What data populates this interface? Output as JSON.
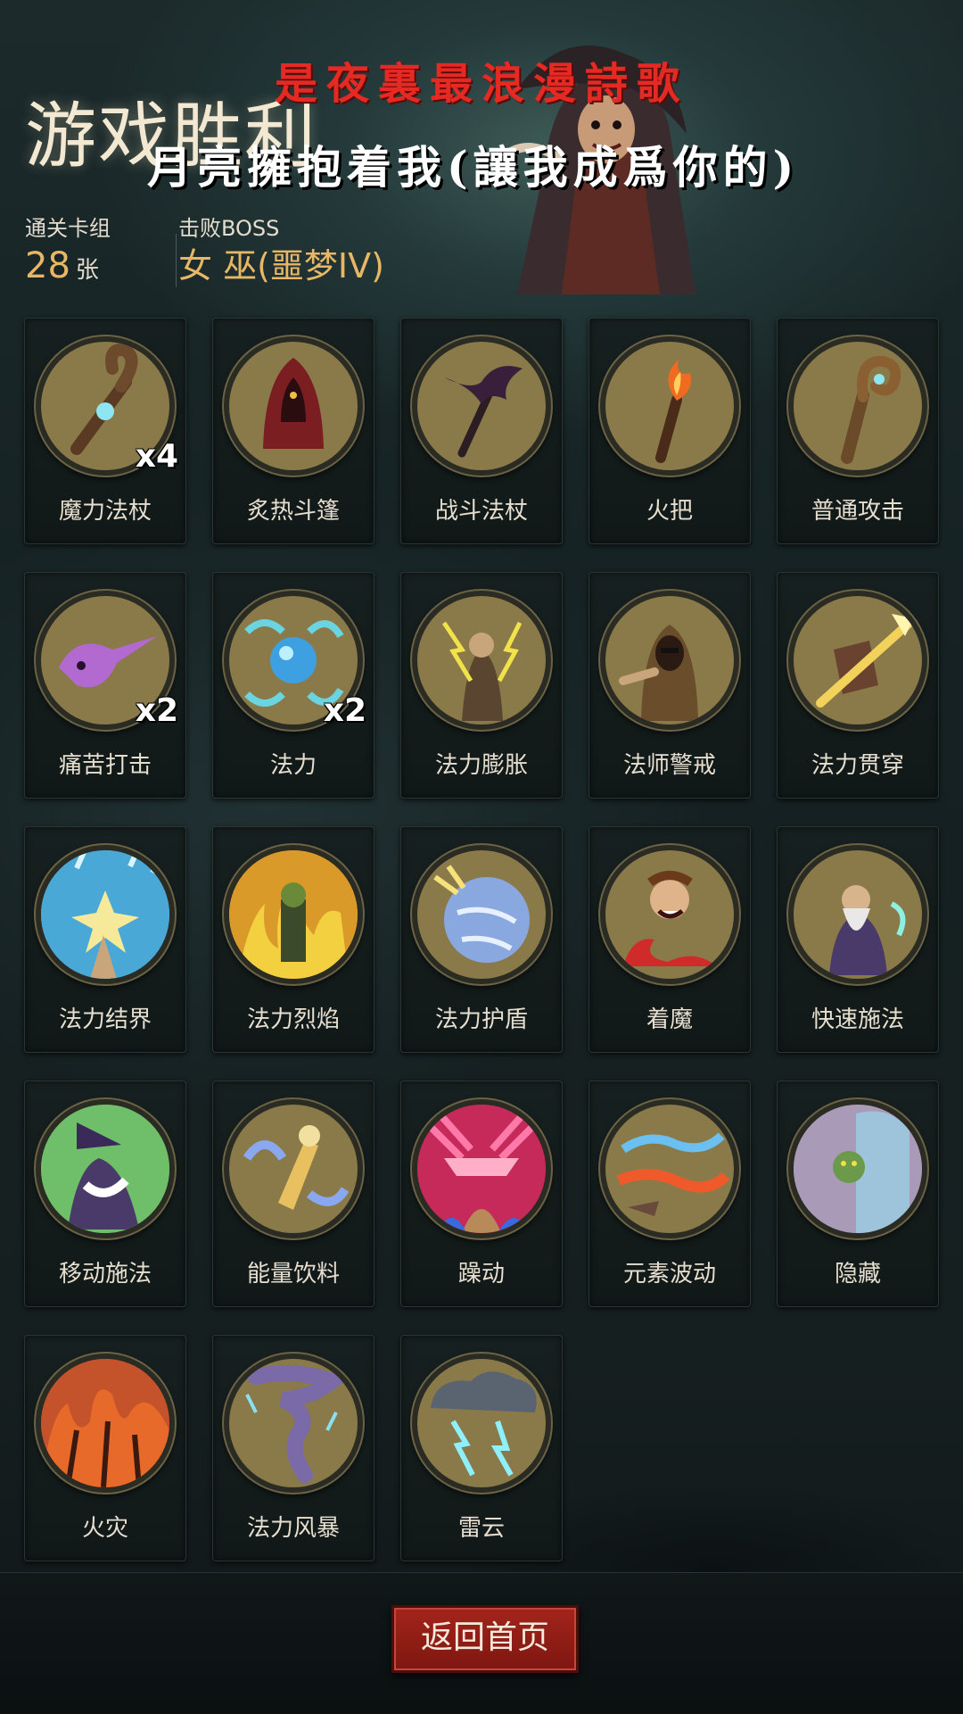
{
  "header": {
    "title": "游戏胜利",
    "overlay_line1": "是夜裏最浪漫詩歌",
    "overlay_line2": "月亮擁抱着我(讓我成爲你的)",
    "deck": {
      "label": "通关卡组",
      "value": "28",
      "unit": "张"
    },
    "boss": {
      "label": "击败BOSS",
      "value": "女 巫(噩梦IV)"
    }
  },
  "cards": [
    {
      "name": "魔力法杖",
      "count": "x4",
      "icon": "mana-staff-icon",
      "tint": "#8a7a4a"
    },
    {
      "name": "炙热斗篷",
      "count": "",
      "icon": "red-cloak-icon",
      "tint": "#8a7a4a"
    },
    {
      "name": "战斗法杖",
      "count": "",
      "icon": "bat-staff-icon",
      "tint": "#8a7a4a"
    },
    {
      "name": "火把",
      "count": "",
      "icon": "torch-icon",
      "tint": "#8a7a4a"
    },
    {
      "name": "普通攻击",
      "count": "",
      "icon": "spiral-staff-icon",
      "tint": "#8a7a4a"
    },
    {
      "name": "痛苦打击",
      "count": "x2",
      "icon": "skull-strike-icon",
      "tint": "#8a7a4a"
    },
    {
      "name": "法力",
      "count": "x2",
      "icon": "mana-orb-icon",
      "tint": "#8a7a4a"
    },
    {
      "name": "法力膨胀",
      "count": "",
      "icon": "lightning-mage-icon",
      "tint": "#8a7a4a"
    },
    {
      "name": "法师警戒",
      "count": "",
      "icon": "hooded-mage-icon",
      "tint": "#8a7a4a"
    },
    {
      "name": "法力贯穿",
      "count": "",
      "icon": "shield-pierce-icon",
      "tint": "#8a7a4a"
    },
    {
      "name": "法力结界",
      "count": "",
      "icon": "barrier-hand-icon",
      "tint": "#49a8d6"
    },
    {
      "name": "法力烈焰",
      "count": "",
      "icon": "flame-zombie-icon",
      "tint": "#d99a2a"
    },
    {
      "name": "法力护盾",
      "count": "",
      "icon": "mana-shield-icon",
      "tint": "#8a7a4a"
    },
    {
      "name": "着魔",
      "count": "",
      "icon": "possessed-icon",
      "tint": "#8a7a4a"
    },
    {
      "name": "快速施法",
      "count": "",
      "icon": "wizard-icon",
      "tint": "#8a7a4a"
    },
    {
      "name": "移动施法",
      "count": "",
      "icon": "witch-cast-icon",
      "tint": "#6fbf6a"
    },
    {
      "name": "能量饮料",
      "count": "",
      "icon": "energy-drink-icon",
      "tint": "#8a7a4a"
    },
    {
      "name": "躁动",
      "count": "",
      "icon": "frenzy-icon",
      "tint": "#c52a5a"
    },
    {
      "name": "元素波动",
      "count": "",
      "icon": "elemental-wave-icon",
      "tint": "#8a7a4a"
    },
    {
      "name": "隐藏",
      "count": "",
      "icon": "hiding-goblin-icon",
      "tint": "#a99ab8"
    },
    {
      "name": "火灾",
      "count": "",
      "icon": "wildfire-icon",
      "tint": "#c4522a"
    },
    {
      "name": "法力风暴",
      "count": "",
      "icon": "tornado-icon",
      "tint": "#8a7a4a"
    },
    {
      "name": "雷云",
      "count": "",
      "icon": "thundercloud-icon",
      "tint": "#8a7a4a"
    }
  ],
  "footer": {
    "home_label": "返回首页"
  }
}
